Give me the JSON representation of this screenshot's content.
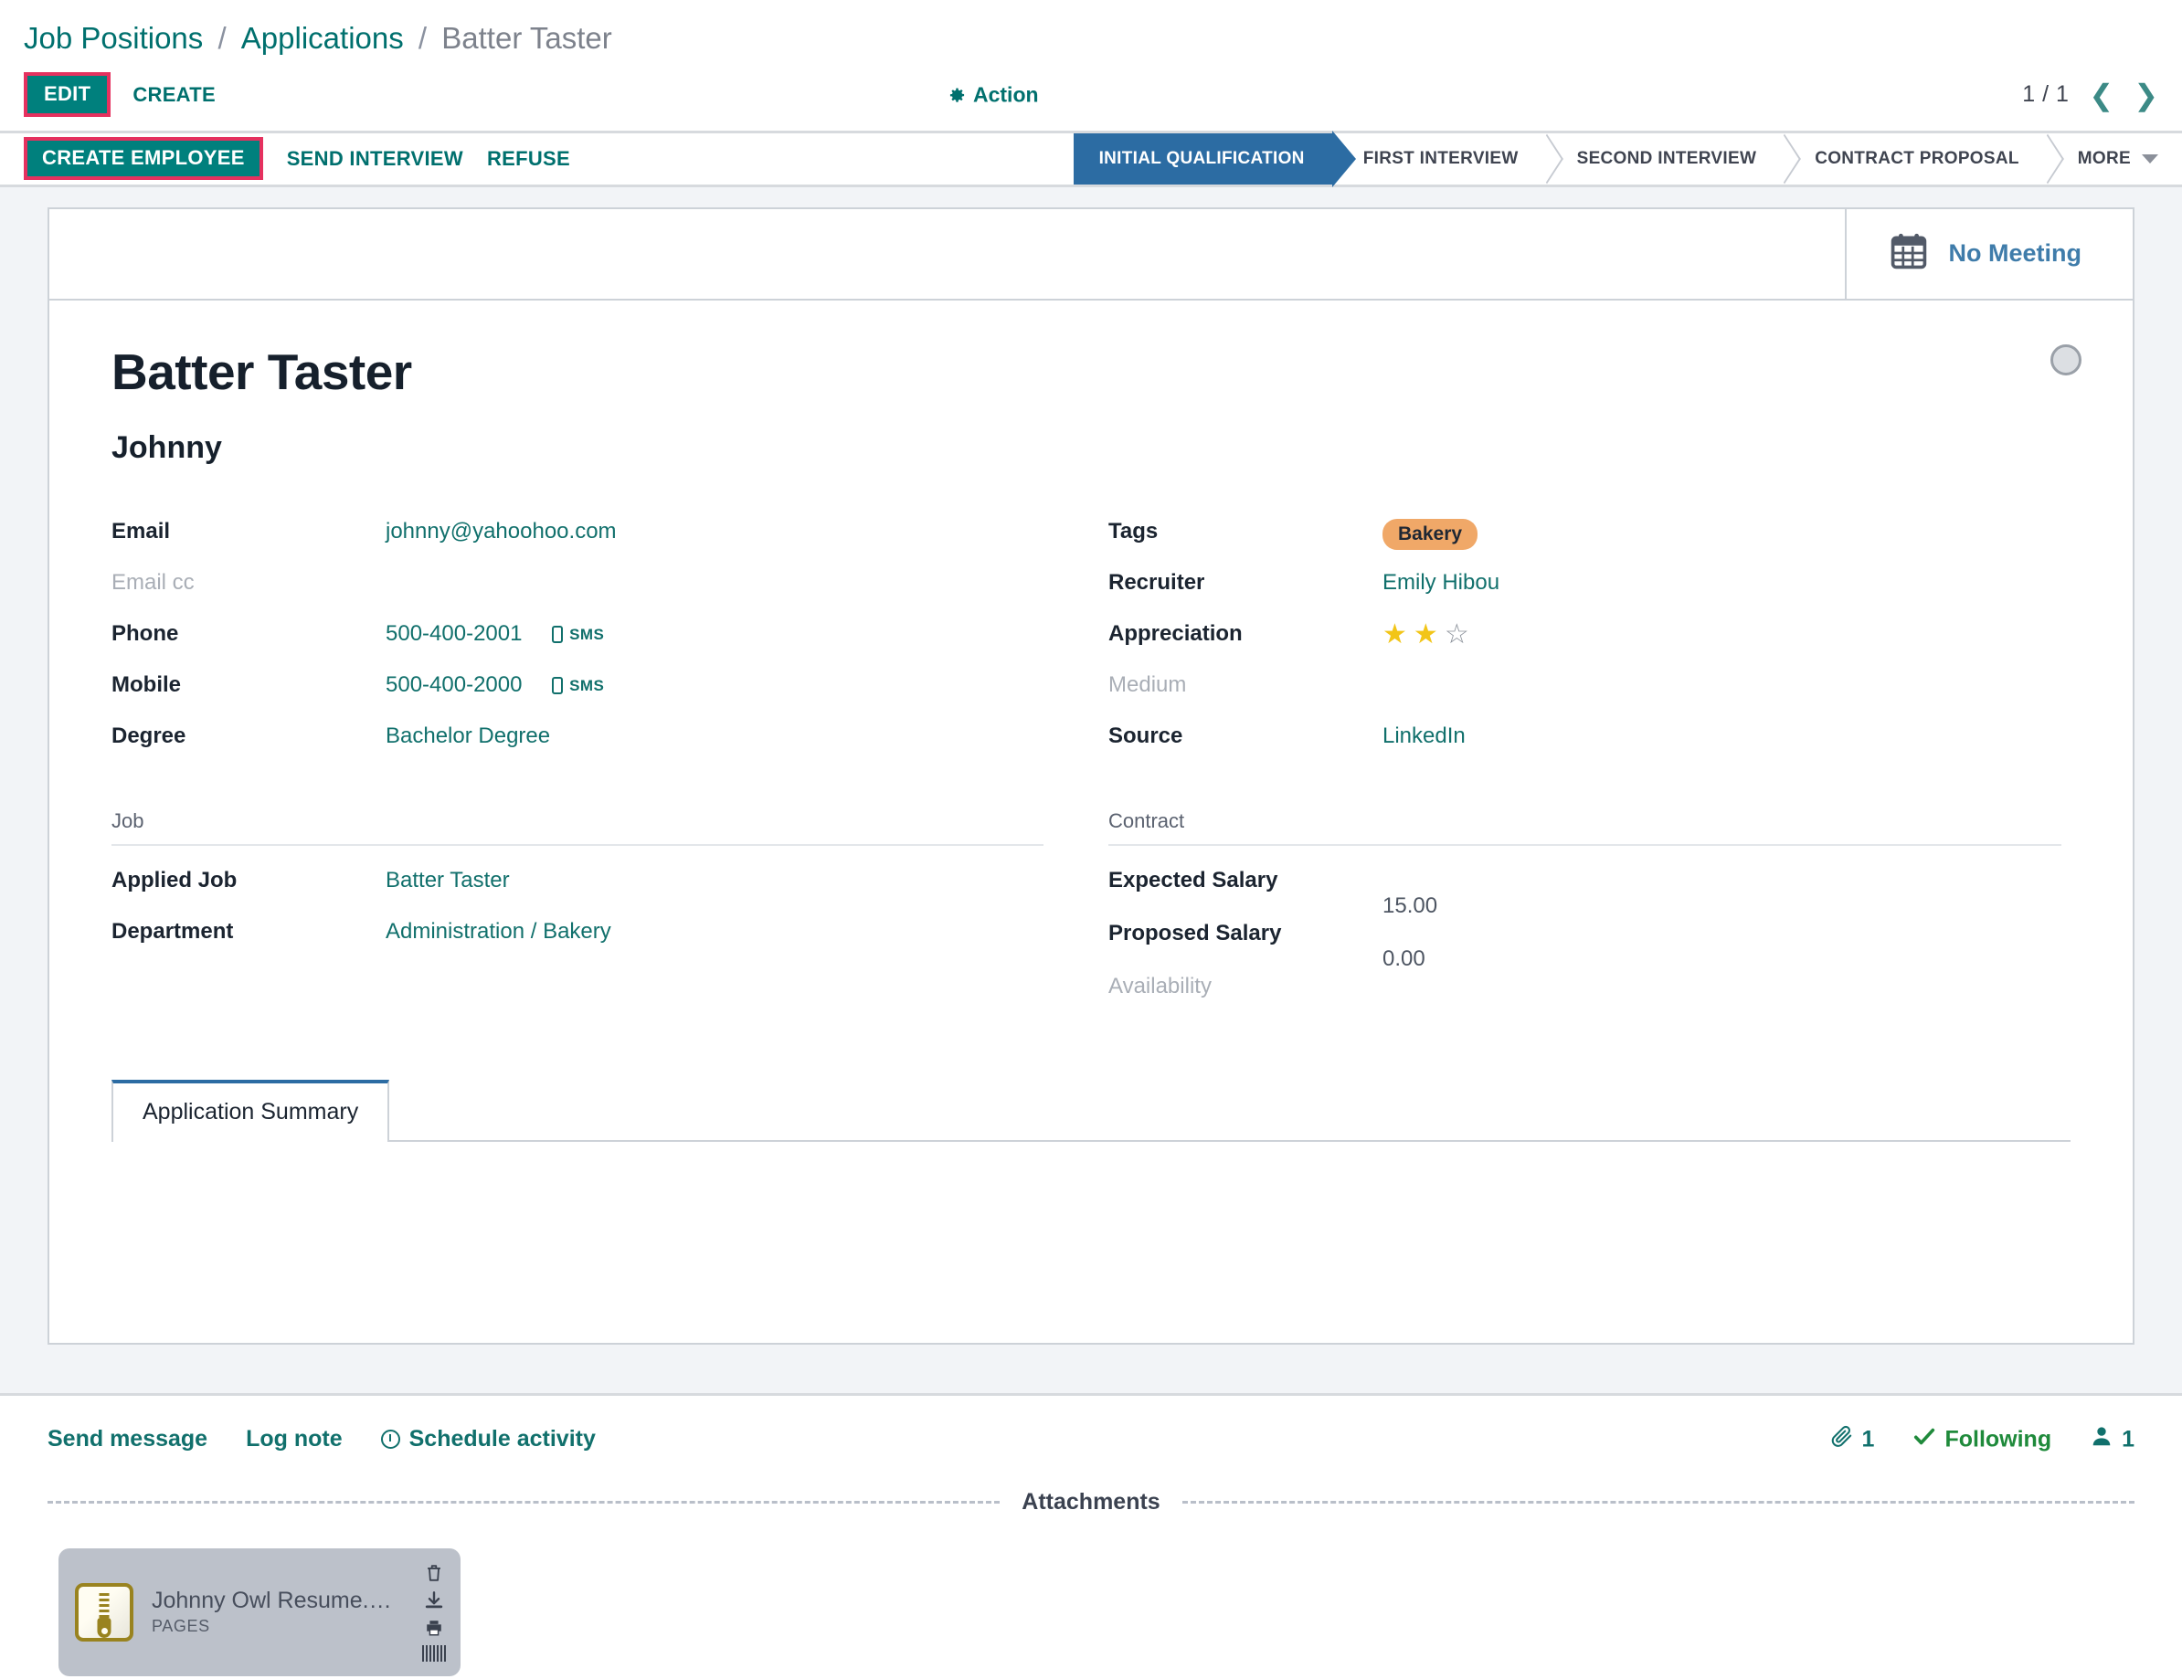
{
  "breadcrumb": {
    "root": "Job Positions",
    "parent": "Applications",
    "current": "Batter Taster",
    "sep": "/"
  },
  "controls": {
    "edit_label": "EDIT",
    "create_label": "CREATE",
    "action_label": "Action",
    "pager_text": "1 / 1",
    "prev_arrow": "❮",
    "next_arrow": "❯"
  },
  "statusbar": {
    "buttons": [
      {
        "label": "CREATE EMPLOYEE",
        "highlighted": true
      },
      {
        "label": "SEND INTERVIEW",
        "highlighted": false
      },
      {
        "label": "REFUSE",
        "highlighted": false
      }
    ],
    "stages": [
      {
        "label": "INITIAL QUALIFICATION",
        "active": true
      },
      {
        "label": "FIRST INTERVIEW",
        "active": false
      },
      {
        "label": "SECOND INTERVIEW",
        "active": false
      },
      {
        "label": "CONTRACT PROPOSAL",
        "active": false
      }
    ],
    "more_label": "MORE",
    "active_color": "#2c6ca3"
  },
  "stat_buttons": [
    {
      "label": "No Meeting",
      "icon": "calendar-icon"
    }
  ],
  "record": {
    "title": "Batter Taster",
    "subtitle": "Johnny"
  },
  "left_fields": [
    {
      "label": "Email",
      "value": "johnny@yahoohoo.com",
      "style": "link"
    },
    {
      "label": "Email cc",
      "value": "",
      "style": "muted"
    },
    {
      "label": "Phone",
      "value": "500-400-2001",
      "style": "link",
      "sms": "SMS"
    },
    {
      "label": "Mobile",
      "value": "500-400-2000",
      "style": "link",
      "sms": "SMS"
    },
    {
      "label": "Degree",
      "value": "Bachelor Degree",
      "style": "link"
    }
  ],
  "left_section": {
    "title": "Job",
    "fields": [
      {
        "label": "Applied Job",
        "value": "Batter Taster",
        "style": "link"
      },
      {
        "label": "Department",
        "value": "Administration / Bakery",
        "style": "link"
      }
    ]
  },
  "right_fields": {
    "tags_label": "Tags",
    "tags": [
      {
        "label": "Bakery",
        "color": "#f0a868"
      }
    ],
    "recruiter_label": "Recruiter",
    "recruiter_value": "Emily Hibou",
    "appreciation_label": "Appreciation",
    "appreciation_filled": 2,
    "appreciation_total": 3,
    "medium_label": "Medium",
    "medium_value": "",
    "source_label": "Source",
    "source_value": "LinkedIn"
  },
  "right_section": {
    "title": "Contract",
    "expected_salary_label": "Expected Salary",
    "expected_salary_value": "15.00",
    "proposed_salary_label": "Proposed Salary",
    "proposed_salary_value": "0.00",
    "availability_label": "Availability",
    "availability_value": ""
  },
  "notebook": {
    "tabs": [
      {
        "label": "Application Summary",
        "active": true
      }
    ],
    "content": ""
  },
  "chatter": {
    "send_message": "Send message",
    "log_note": "Log note",
    "schedule_activity": "Schedule activity",
    "attachment_count": "1",
    "following_label": "Following",
    "follower_count": "1"
  },
  "attachments": {
    "divider_label": "Attachments",
    "files": [
      {
        "name": "Johnny Owl Resume.pages",
        "type": "PAGES"
      }
    ]
  }
}
